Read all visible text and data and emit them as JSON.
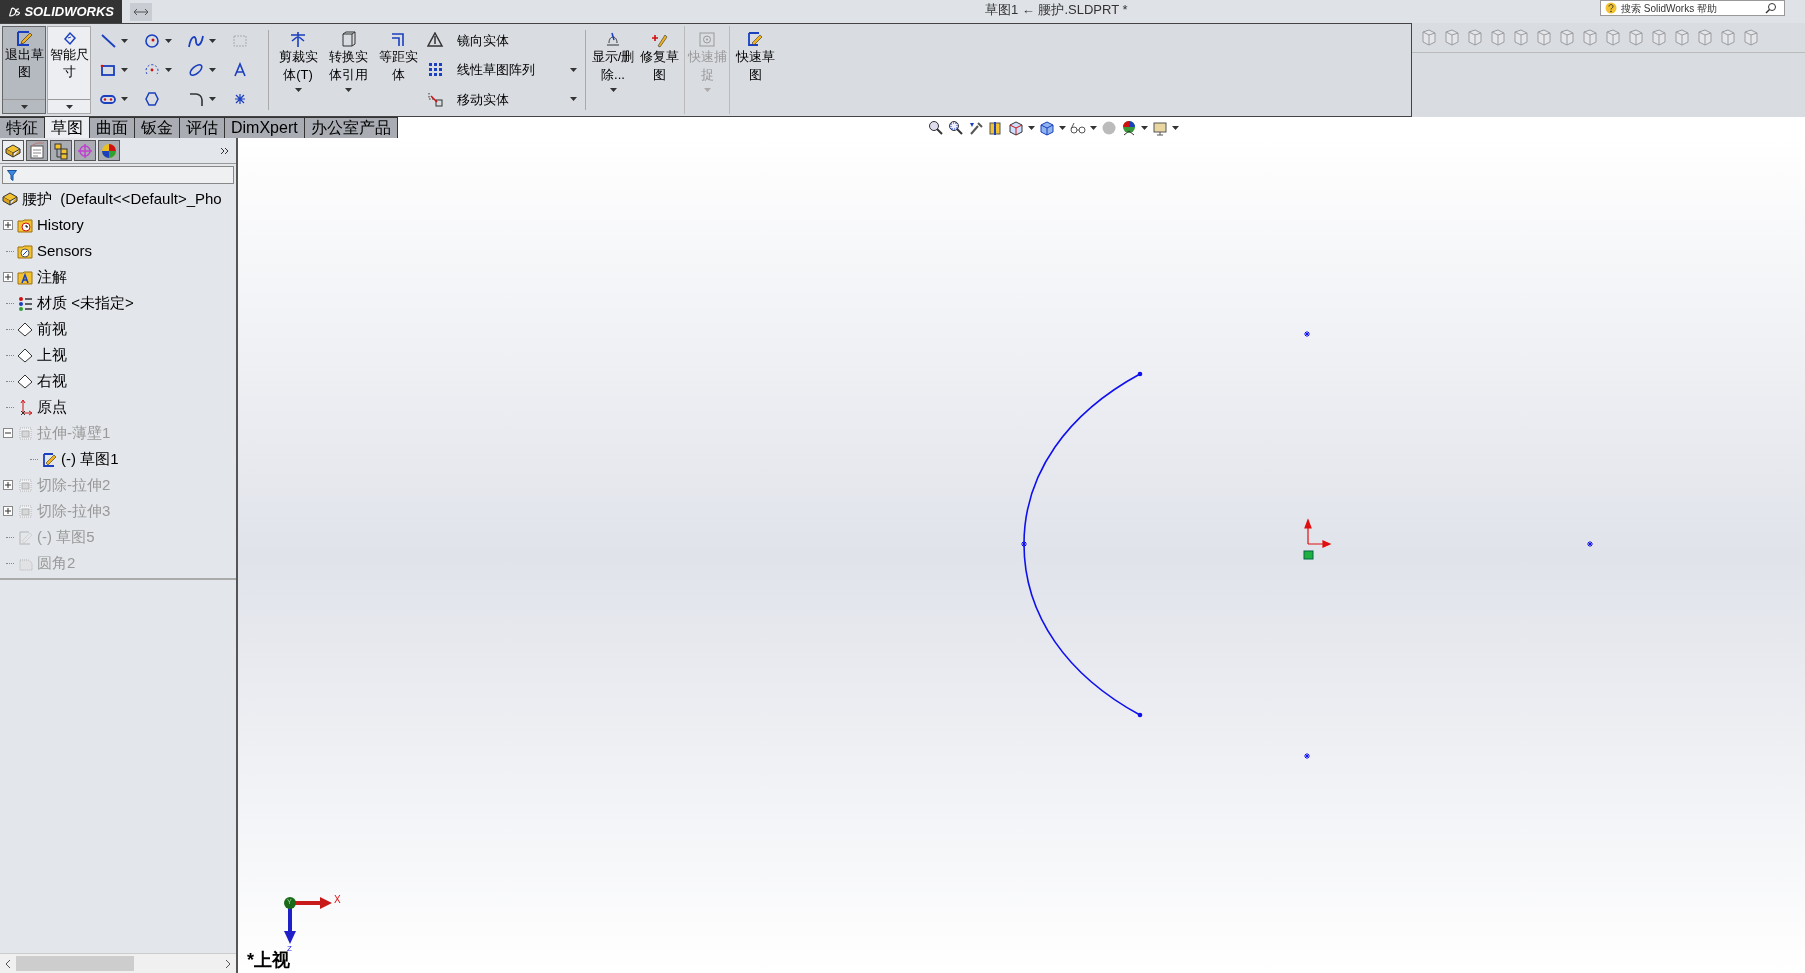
{
  "title_bar": {
    "logo": "SOLIDWORKS",
    "title": "草图1 ← 腰护.SLDPRT *",
    "search": {
      "placeholder": "搜索 SolidWorks 帮助"
    }
  },
  "ribbon": {
    "left_buttons": [
      {
        "label": "退出草图",
        "selected": true
      },
      {
        "label": "智能尺寸",
        "selected": false
      }
    ],
    "middle_buttons": [
      {
        "label": "剪裁实体(T)",
        "kind": "trim"
      },
      {
        "label": "转换实体引用",
        "kind": "convert"
      },
      {
        "label": "等距实体",
        "kind": "offset"
      }
    ],
    "list_tools": [
      {
        "label": "镜向实体",
        "kind": "mirror"
      },
      {
        "label": "线性草图阵列",
        "kind": "pattern"
      },
      {
        "label": "移动实体",
        "kind": "move"
      }
    ],
    "right_buttons": [
      {
        "label": "显示/删除...",
        "kind": "relations",
        "disabled": false
      },
      {
        "label": "修复草图",
        "kind": "repair",
        "disabled": false
      },
      {
        "label": "快速捕捉",
        "kind": "snap",
        "disabled": true
      },
      {
        "label": "快速草图",
        "kind": "quick",
        "disabled": false
      }
    ]
  },
  "tabs": [
    {
      "label": "特征",
      "selected": false
    },
    {
      "label": "草图",
      "selected": true
    },
    {
      "label": "曲面",
      "selected": false
    },
    {
      "label": "钣金",
      "selected": false
    },
    {
      "label": "评估",
      "selected": false
    },
    {
      "label": "DimXpert",
      "selected": false
    },
    {
      "label": "办公室产品",
      "selected": false
    }
  ],
  "tree": {
    "root": "腰护  (Default<<Default>_Pho",
    "items": [
      {
        "label": "History",
        "kind": "history",
        "expanded": false,
        "dimmed": false
      },
      {
        "label": "Sensors",
        "kind": "sensors",
        "dimmed": false
      },
      {
        "label": "注解",
        "kind": "annotations",
        "expanded": false,
        "dimmed": false
      },
      {
        "label": "材质 <未指定>",
        "kind": "material",
        "dimmed": false
      },
      {
        "label": "前视",
        "kind": "plane",
        "dimmed": false
      },
      {
        "label": "上视",
        "kind": "plane",
        "dimmed": false
      },
      {
        "label": "右视",
        "kind": "plane",
        "dimmed": false
      },
      {
        "label": "原点",
        "kind": "origin",
        "dimmed": false
      },
      {
        "label": "拉伸-薄壁1",
        "kind": "feature",
        "expanded": true,
        "dimmed": true,
        "children": [
          {
            "label": "(-) 草图1",
            "kind": "sketch",
            "dimmed": false
          }
        ]
      },
      {
        "label": "切除-拉伸2",
        "kind": "feature",
        "expanded": false,
        "dimmed": true
      },
      {
        "label": "切除-拉伸3",
        "kind": "feature",
        "expanded": false,
        "dimmed": true
      },
      {
        "label": "(-) 草图5",
        "kind": "sketch",
        "dimmed": true
      },
      {
        "label": "圆角2",
        "kind": "fillet",
        "dimmed": true
      }
    ]
  },
  "panel_tabs": [
    {
      "selected": true
    },
    {
      "selected": false
    },
    {
      "selected": false
    },
    {
      "selected": false
    },
    {
      "selected": false
    }
  ],
  "viewport": {
    "view_label": "*上视",
    "axes": [
      "X",
      "Y",
      "Z"
    ]
  }
}
